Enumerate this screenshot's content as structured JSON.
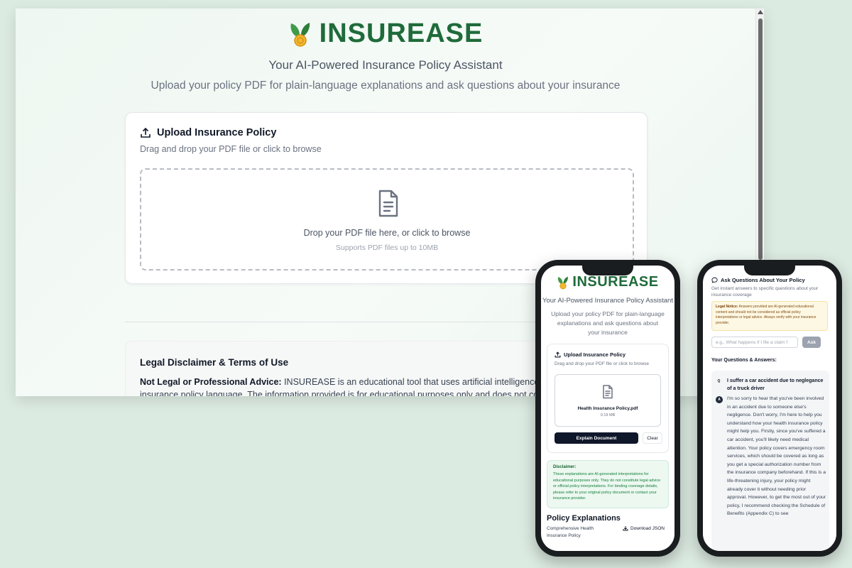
{
  "brand": {
    "name": "INSUREASE",
    "tagline": "Your AI-Powered Insurance Policy Assistant",
    "subtitle": "Upload your policy PDF for plain-language explanations and ask questions about your insurance"
  },
  "upload": {
    "title": "Upload Insurance Policy",
    "description": "Drag and drop your PDF file or click to browse",
    "drop_text": "Drop your PDF file here, or click to browse",
    "hint": "Supports PDF files up to 10MB"
  },
  "legal": {
    "title": "Legal Disclaimer & Terms of Use",
    "label": "Not Legal or Professional Advice:",
    "text": "INSUREASE is an educational tool that uses artificial intelligence to provide insurance policy language. The information provided is for educational purposes only and does not constitute"
  },
  "mobile_upload": {
    "brand": "INSUREASE",
    "tagline": "Your AI-Powered Insurance Policy Assistant",
    "subtitle": "Upload your policy PDF for plain-language explanations and ask questions about your insurance",
    "card_title": "Upload Insurance Policy",
    "card_desc": "Drag and drop your PDF file or click to browse",
    "file_name": "Health Insurance Policy.pdf",
    "file_size": "0.19 MB",
    "explain_button": "Explain Document",
    "clear_button": "Clear",
    "disclaimer_title": "Disclaimer:",
    "disclaimer_text": "These explanations are AI-generated interpretations for educational purposes only. They do not constitute legal advice or official policy interpretations. For binding coverage details, please refer to your original policy document or contact your insurance provider.",
    "explanations_title": "Policy Explanations",
    "explanations_subtitle": "Comprehensive Health Insurance Policy",
    "download_button": "Download JSON"
  },
  "mobile_qa": {
    "title": "Ask Questions About Your Policy",
    "description": "Get instant answers to specific questions about your insurance coverage",
    "notice_label": "Legal Notice:",
    "notice_text": "Answers provided are AI-generated educational content and should not be considered as official policy interpretations or legal advice. Always verify with your insurance provider.",
    "input_placeholder": "e.g., What happens if I file a claim f",
    "ask_button": "Ask",
    "qa_title": "Your Questions & Answers:",
    "q_badge": "Q",
    "question": "I suffer a car accident due to neglegance of a truck driver",
    "a_badge": "A",
    "answer": "I'm so sorry to hear that you've been involved in an accident due to someone else's negligence. Don't worry, I'm here to help you understand how your health insurance policy might help you. Firstly, since you've suffered a car accident, you'll likely need medical attention. Your policy covers emergency room services, which should be covered as long as you get a special authorization number from the insurance company beforehand. If this is a life-threatening injury, your policy might already cover it without needing prior approval. However, to get the most out of your policy, I recommend checking the Schedule of Benefits (Appendix C) to see"
  },
  "colors": {
    "brand_green": "#1f6b3a",
    "background": "#dcebe2",
    "button_dark": "#0f172a"
  }
}
